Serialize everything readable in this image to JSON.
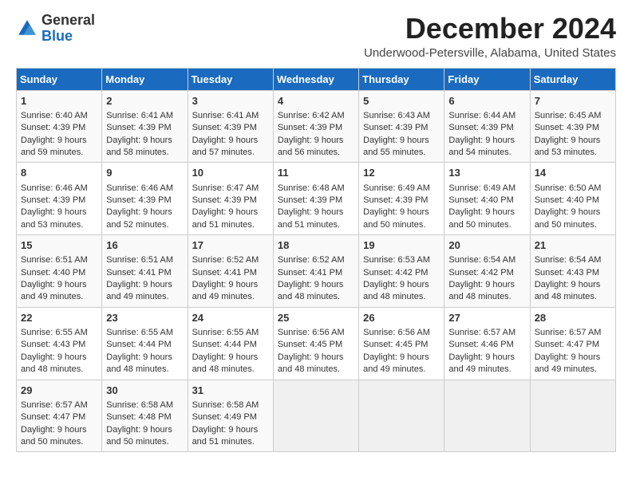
{
  "logo": {
    "text_general": "General",
    "text_blue": "Blue"
  },
  "header": {
    "month": "December 2024",
    "location": "Underwood-Petersville, Alabama, United States"
  },
  "weekdays": [
    "Sunday",
    "Monday",
    "Tuesday",
    "Wednesday",
    "Thursday",
    "Friday",
    "Saturday"
  ],
  "weeks": [
    [
      {
        "day": "1",
        "sunrise": "6:40 AM",
        "sunset": "4:39 PM",
        "daylight": "9 hours and 59 minutes."
      },
      {
        "day": "2",
        "sunrise": "6:41 AM",
        "sunset": "4:39 PM",
        "daylight": "9 hours and 58 minutes."
      },
      {
        "day": "3",
        "sunrise": "6:41 AM",
        "sunset": "4:39 PM",
        "daylight": "9 hours and 57 minutes."
      },
      {
        "day": "4",
        "sunrise": "6:42 AM",
        "sunset": "4:39 PM",
        "daylight": "9 hours and 56 minutes."
      },
      {
        "day": "5",
        "sunrise": "6:43 AM",
        "sunset": "4:39 PM",
        "daylight": "9 hours and 55 minutes."
      },
      {
        "day": "6",
        "sunrise": "6:44 AM",
        "sunset": "4:39 PM",
        "daylight": "9 hours and 54 minutes."
      },
      {
        "day": "7",
        "sunrise": "6:45 AM",
        "sunset": "4:39 PM",
        "daylight": "9 hours and 53 minutes."
      }
    ],
    [
      {
        "day": "8",
        "sunrise": "6:46 AM",
        "sunset": "4:39 PM",
        "daylight": "9 hours and 53 minutes."
      },
      {
        "day": "9",
        "sunrise": "6:46 AM",
        "sunset": "4:39 PM",
        "daylight": "9 hours and 52 minutes."
      },
      {
        "day": "10",
        "sunrise": "6:47 AM",
        "sunset": "4:39 PM",
        "daylight": "9 hours and 51 minutes."
      },
      {
        "day": "11",
        "sunrise": "6:48 AM",
        "sunset": "4:39 PM",
        "daylight": "9 hours and 51 minutes."
      },
      {
        "day": "12",
        "sunrise": "6:49 AM",
        "sunset": "4:39 PM",
        "daylight": "9 hours and 50 minutes."
      },
      {
        "day": "13",
        "sunrise": "6:49 AM",
        "sunset": "4:40 PM",
        "daylight": "9 hours and 50 minutes."
      },
      {
        "day": "14",
        "sunrise": "6:50 AM",
        "sunset": "4:40 PM",
        "daylight": "9 hours and 50 minutes."
      }
    ],
    [
      {
        "day": "15",
        "sunrise": "6:51 AM",
        "sunset": "4:40 PM",
        "daylight": "9 hours and 49 minutes."
      },
      {
        "day": "16",
        "sunrise": "6:51 AM",
        "sunset": "4:41 PM",
        "daylight": "9 hours and 49 minutes."
      },
      {
        "day": "17",
        "sunrise": "6:52 AM",
        "sunset": "4:41 PM",
        "daylight": "9 hours and 49 minutes."
      },
      {
        "day": "18",
        "sunrise": "6:52 AM",
        "sunset": "4:41 PM",
        "daylight": "9 hours and 48 minutes."
      },
      {
        "day": "19",
        "sunrise": "6:53 AM",
        "sunset": "4:42 PM",
        "daylight": "9 hours and 48 minutes."
      },
      {
        "day": "20",
        "sunrise": "6:54 AM",
        "sunset": "4:42 PM",
        "daylight": "9 hours and 48 minutes."
      },
      {
        "day": "21",
        "sunrise": "6:54 AM",
        "sunset": "4:43 PM",
        "daylight": "9 hours and 48 minutes."
      }
    ],
    [
      {
        "day": "22",
        "sunrise": "6:55 AM",
        "sunset": "4:43 PM",
        "daylight": "9 hours and 48 minutes."
      },
      {
        "day": "23",
        "sunrise": "6:55 AM",
        "sunset": "4:44 PM",
        "daylight": "9 hours and 48 minutes."
      },
      {
        "day": "24",
        "sunrise": "6:55 AM",
        "sunset": "4:44 PM",
        "daylight": "9 hours and 48 minutes."
      },
      {
        "day": "25",
        "sunrise": "6:56 AM",
        "sunset": "4:45 PM",
        "daylight": "9 hours and 48 minutes."
      },
      {
        "day": "26",
        "sunrise": "6:56 AM",
        "sunset": "4:45 PM",
        "daylight": "9 hours and 49 minutes."
      },
      {
        "day": "27",
        "sunrise": "6:57 AM",
        "sunset": "4:46 PM",
        "daylight": "9 hours and 49 minutes."
      },
      {
        "day": "28",
        "sunrise": "6:57 AM",
        "sunset": "4:47 PM",
        "daylight": "9 hours and 49 minutes."
      }
    ],
    [
      {
        "day": "29",
        "sunrise": "6:57 AM",
        "sunset": "4:47 PM",
        "daylight": "9 hours and 50 minutes."
      },
      {
        "day": "30",
        "sunrise": "6:58 AM",
        "sunset": "4:48 PM",
        "daylight": "9 hours and 50 minutes."
      },
      {
        "day": "31",
        "sunrise": "6:58 AM",
        "sunset": "4:49 PM",
        "daylight": "9 hours and 51 minutes."
      },
      null,
      null,
      null,
      null
    ]
  ]
}
